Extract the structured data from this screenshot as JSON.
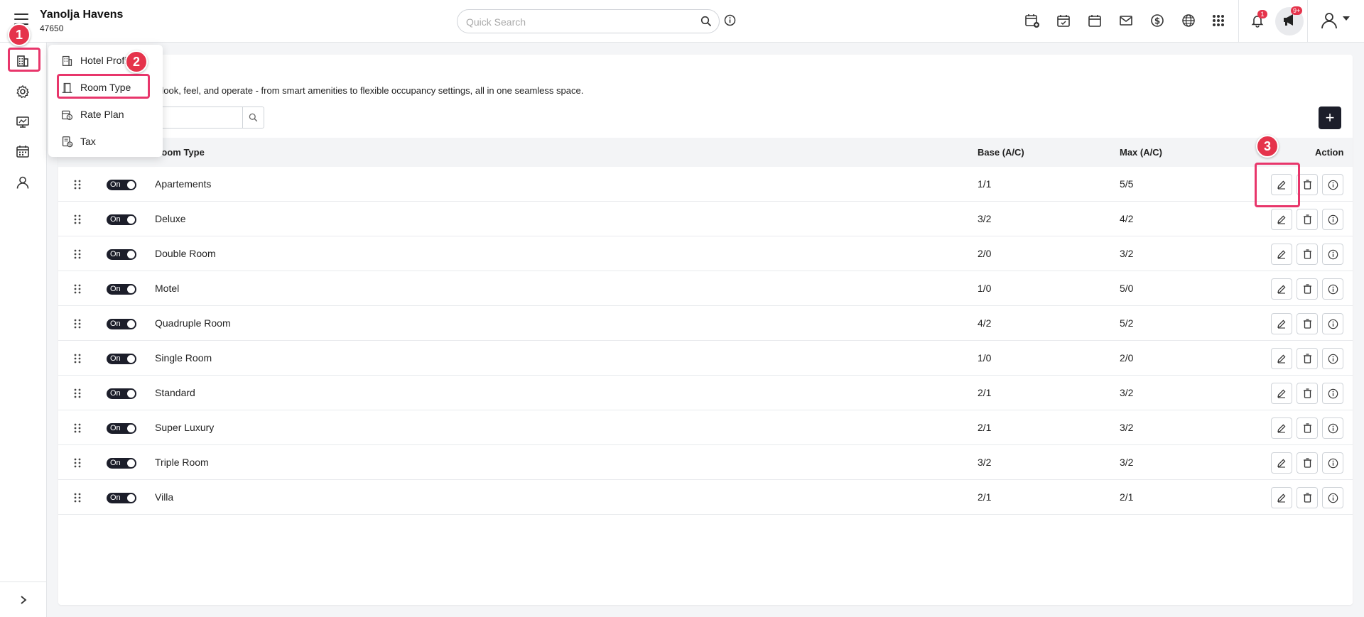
{
  "header": {
    "hotel_name": "Yanolja Havens",
    "hotel_id": "47650",
    "search_placeholder": "Quick Search",
    "notification_badge": "1",
    "announcement_badge": "9+"
  },
  "menu": {
    "items": [
      {
        "label": "Hotel Profile",
        "icon": "building-icon"
      },
      {
        "label": "Room Type",
        "icon": "door-icon"
      },
      {
        "label": "Rate Plan",
        "icon": "rate-plan-icon"
      },
      {
        "label": "Tax",
        "icon": "tax-icon"
      }
    ]
  },
  "page": {
    "description": "ns look, feel, and operate - from smart amenities to flexible occupancy settings, all in one seamless space.",
    "add_label": "+"
  },
  "table": {
    "headers": {
      "room_type": "Room Type",
      "base": "Base (A/C)",
      "max": "Max (A/C)",
      "action": "Action"
    },
    "toggle_label": "On",
    "rows": [
      {
        "name": "Apartements",
        "base": "1/1",
        "max": "5/5"
      },
      {
        "name": "Deluxe",
        "base": "3/2",
        "max": "4/2"
      },
      {
        "name": "Double Room",
        "base": "2/0",
        "max": "3/2"
      },
      {
        "name": "Motel",
        "base": "1/0",
        "max": "5/0"
      },
      {
        "name": "Quadruple Room",
        "base": "4/2",
        "max": "5/2"
      },
      {
        "name": "Single Room",
        "base": "1/0",
        "max": "2/0"
      },
      {
        "name": "Standard",
        "base": "2/1",
        "max": "3/2"
      },
      {
        "name": "Super Luxury",
        "base": "2/1",
        "max": "3/2"
      },
      {
        "name": "Triple Room",
        "base": "3/2",
        "max": "3/2"
      },
      {
        "name": "Villa",
        "base": "2/1",
        "max": "2/1"
      }
    ]
  },
  "annotations": {
    "step1": "1",
    "step2": "2",
    "step3": "3",
    "color": "#e8366b"
  }
}
